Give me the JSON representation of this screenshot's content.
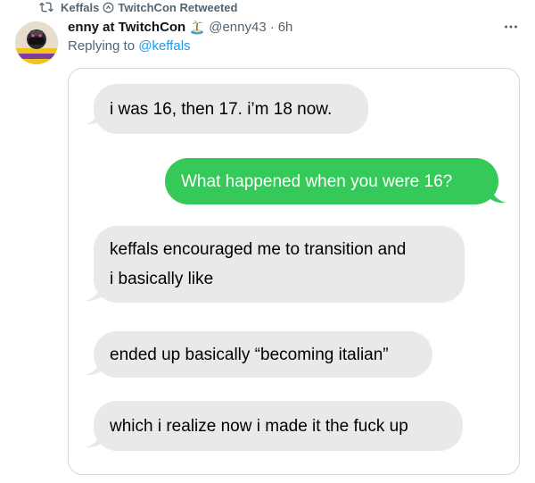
{
  "retweet": {
    "icon": "retweet-icon",
    "prefix": "Keffals",
    "linked_icon": "linked-account-icon",
    "suffix": "TwitchCon Retweeted"
  },
  "author": {
    "display_name": "enny at TwitchCon",
    "name_emoji": "island-emoji-icon",
    "handle": "@enny43",
    "time": "6h"
  },
  "reply": {
    "prefix": "Replying to",
    "mention": "@keffals"
  },
  "colors": {
    "mention_blue": "#1d9bf0",
    "gray_bubble": "#e9e9eb",
    "green_bubble": "#35c95a"
  },
  "messages": [
    {
      "side": "left",
      "text": "i was 16, then 17. i’m 18 now."
    },
    {
      "side": "right",
      "text": "What happened when you were 16?"
    },
    {
      "side": "left",
      "lines": [
        "keffals encouraged me to transition and",
        "i basically like"
      ]
    },
    {
      "side": "left",
      "text": "ended up basically “becoming italian”"
    },
    {
      "side": "left",
      "text": "which i realize now i made it the fuck up"
    }
  ]
}
